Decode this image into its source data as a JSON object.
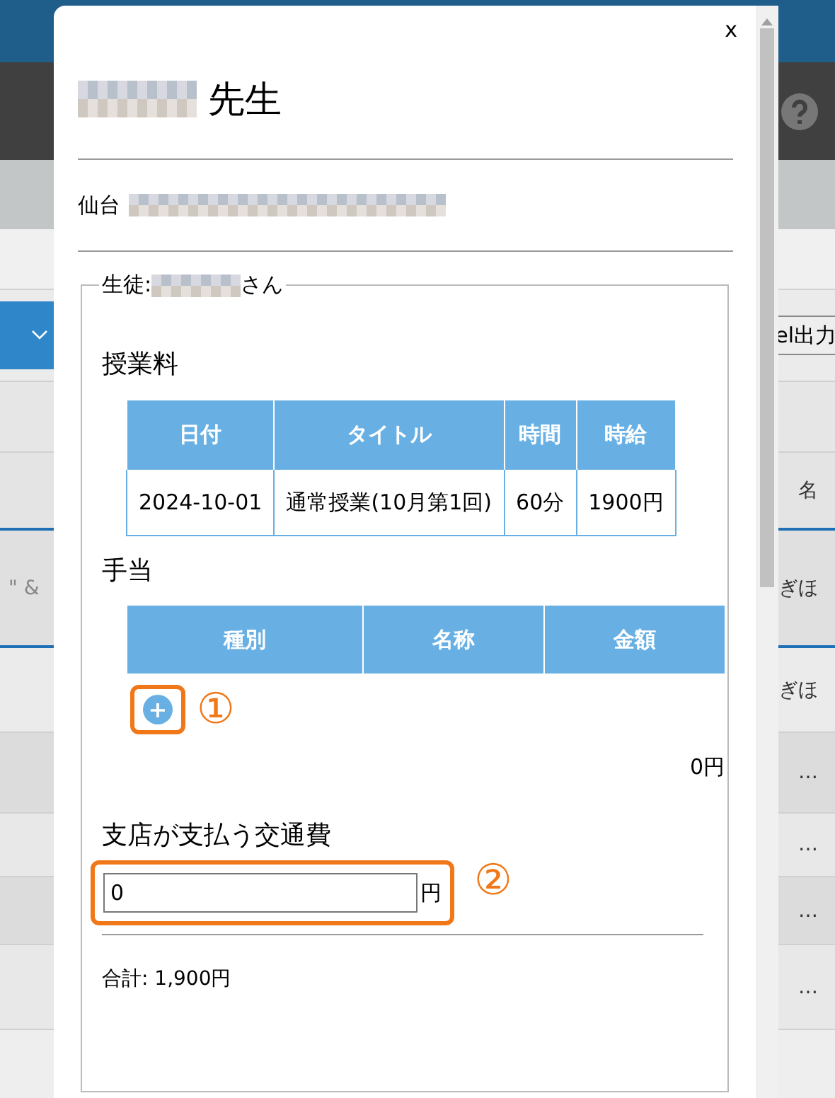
{
  "background": {
    "export_button": "el出力",
    "table_header_right": "名",
    "rows": [
      {
        "left": "\" &",
        "right": "ぎほ"
      },
      {
        "left": "",
        "right": "ぎほ"
      },
      {
        "left": "",
        "right": "…"
      },
      {
        "left": "",
        "right": "…"
      },
      {
        "left": "",
        "right": "…"
      },
      {
        "left": "",
        "right": "…"
      }
    ]
  },
  "dialog": {
    "close": "x",
    "title_suffix": "先生",
    "branch": "仙台",
    "student_prefix": "生徒:",
    "student_suffix": "さん",
    "lesson_section": "授業料",
    "lesson_columns": [
      "日付",
      "タイトル",
      "時間",
      "時給"
    ],
    "lesson_rows": [
      [
        "2024-10-01",
        "通常授業(10月第1回)",
        "60分",
        "1900円"
      ]
    ],
    "allowance_section": "手当",
    "allowance_columns": [
      "種別",
      "名称",
      "金額"
    ],
    "add_button": "+",
    "allowance_total": "0円",
    "transport_label": "支店が支払う交通費",
    "transport_value": "0",
    "transport_unit": "円",
    "total": "合計: 1,900円"
  },
  "callouts": [
    "①",
    "②"
  ]
}
